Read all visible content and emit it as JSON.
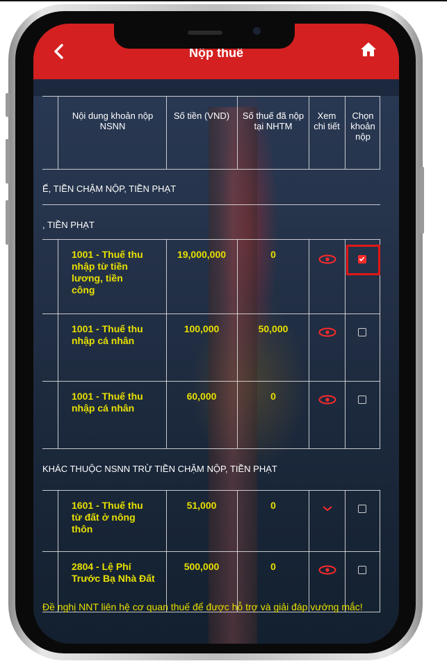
{
  "app": {
    "title": "Nộp thuế"
  },
  "table": {
    "headers": [
      "Nội dung khoản nộp NSNN",
      "Số tiền (VND)",
      "Số thuế đã nộp tại NHTM",
      "Xem chi tiết",
      "Chọn khoản nộp"
    ],
    "sections": [
      "Ế, TIỀN CHẬM NỘP, TIỀN PHẠT",
      ", TIỀN PHẠT",
      "KHÁC THUỘC NSNN TRỪ TIỀN CHẬM NỘP, TIỀN PHẠT"
    ],
    "rows": [
      {
        "content": "1001 - Thuế thu nhập từ tiền lương, tiền công",
        "amount": "19,000,000",
        "paid": "0",
        "selected": true
      },
      {
        "content": "1001 - Thuế thu nhập cá nhân",
        "amount": "100,000",
        "paid": "50,000",
        "selected": false
      },
      {
        "content": "1001 - Thuế thu nhập cá nhân",
        "amount": "60,000",
        "paid": "0",
        "selected": false
      },
      {
        "content": "1601 - Thuế thu từ đất ở nông thôn",
        "amount": "51,000",
        "paid": "0",
        "selected": false
      },
      {
        "content": "2804 - Lệ Phí Trước Bạ Nhà Đất",
        "amount": "500,000",
        "paid": "0",
        "selected": false
      }
    ]
  },
  "note": "Đề nghị NNT liên hệ cơ quan thuế để được hỗ trợ và giải đáp vướng mắc!",
  "icons": {
    "back": "chevron-left-icon",
    "home": "home-icon",
    "view": "eye-icon",
    "select": "checkbox-icon"
  },
  "colors": {
    "header": "#d42020",
    "highlight_text": "#e8e000",
    "accent": "#ff2a2a"
  }
}
